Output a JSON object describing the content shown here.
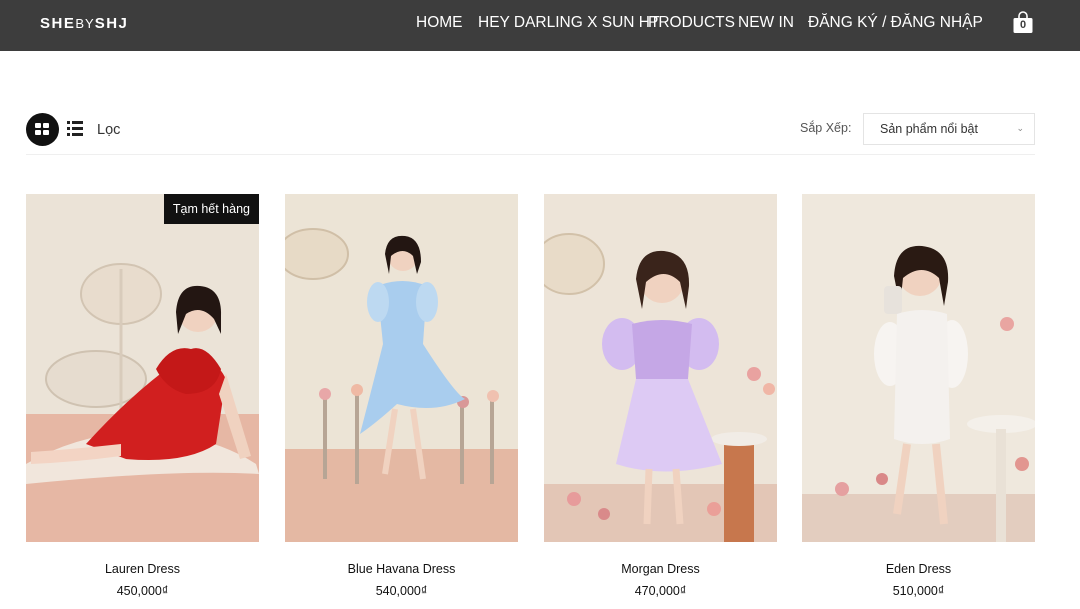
{
  "header": {
    "logo": {
      "part1": "SHE",
      "part2": "BY",
      "part3": "SHJ"
    },
    "nav": [
      "HOME",
      "HEY DARLING X SUN HT",
      "PRODUCTS",
      "NEW IN",
      "ĐĂNG KÝ / ĐĂNG NHẬP"
    ],
    "cart_count": "0",
    "colors": {
      "bar": "#3d3d3d",
      "text": "#ffffff"
    }
  },
  "toolbar": {
    "filter_label": "Lọc",
    "sort_label": "Sắp Xếp:",
    "sort_value": "Sản phẩm nổi bật",
    "view_icons": [
      "grid-view-icon",
      "list-view-icon"
    ]
  },
  "products": [
    {
      "name": "Lauren Dress",
      "price": "450,000₫",
      "badge": "Tạm hết hàng",
      "dress_color": "#d11f1f"
    },
    {
      "name": "Blue Havana Dress",
      "price": "540,000₫",
      "badge": "",
      "dress_color": "#a9cdee"
    },
    {
      "name": "Morgan Dress",
      "price": "470,000₫",
      "badge": "",
      "dress_color": "#c5a7e6"
    },
    {
      "name": "Eden Dress",
      "price": "510,000₫",
      "badge": "",
      "dress_color": "#f4f1ee"
    }
  ]
}
